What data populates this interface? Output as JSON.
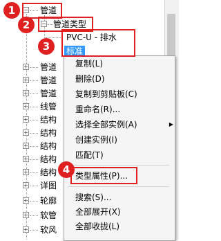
{
  "tree": {
    "root_label": "管道",
    "child_label": "管道类型",
    "grandchild_label": "PVC-U - 排水",
    "selected_label": "标准",
    "siblings": [
      "管道",
      "管道",
      "管道",
      "线管",
      "结构",
      "结构",
      "结构",
      "结构",
      "结构",
      "详图",
      "轮廓",
      "软管",
      "软风"
    ]
  },
  "menu": {
    "items": [
      "复制(L)",
      "删除(D)",
      "复制到剪贴板(C)",
      "重命名(R)...",
      "选择全部实例(A)",
      "创建实例(I)",
      "匹配(T)",
      "类型属性(P)...",
      "搜索(S)...",
      "全部展开(X)",
      "全部收拢(L)"
    ],
    "submenu_arrow": "▶"
  },
  "annotations": {
    "badges": [
      "1",
      "2",
      "3",
      "4"
    ],
    "color": "#e02020"
  },
  "icons": {
    "collapse": "−",
    "expand": "+"
  }
}
